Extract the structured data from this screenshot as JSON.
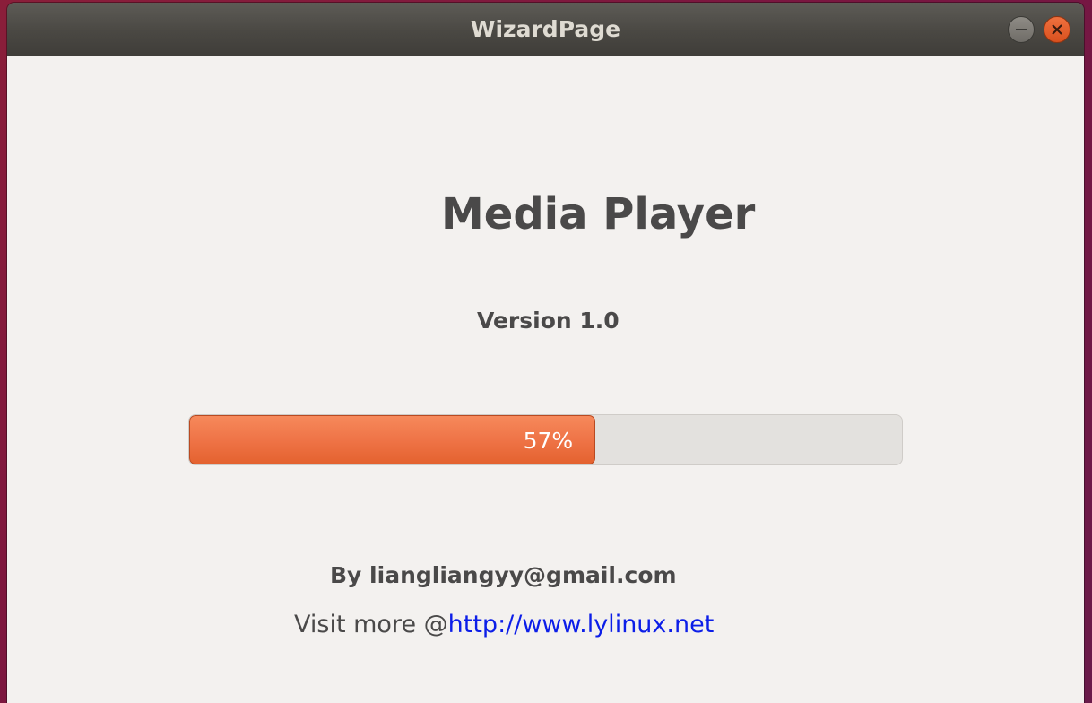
{
  "window": {
    "title": "WizardPage"
  },
  "page": {
    "app_title": "Media Player",
    "version": "Version 1.0",
    "progress": {
      "percent": 57,
      "label": "57%",
      "fill_color": "#ef7447"
    },
    "author": "By liangliangyy@gmail.com",
    "visit_prefix": "Visit more @",
    "visit_link": "http://www.lylinux.net",
    "link_color": "#0c1ee8"
  }
}
